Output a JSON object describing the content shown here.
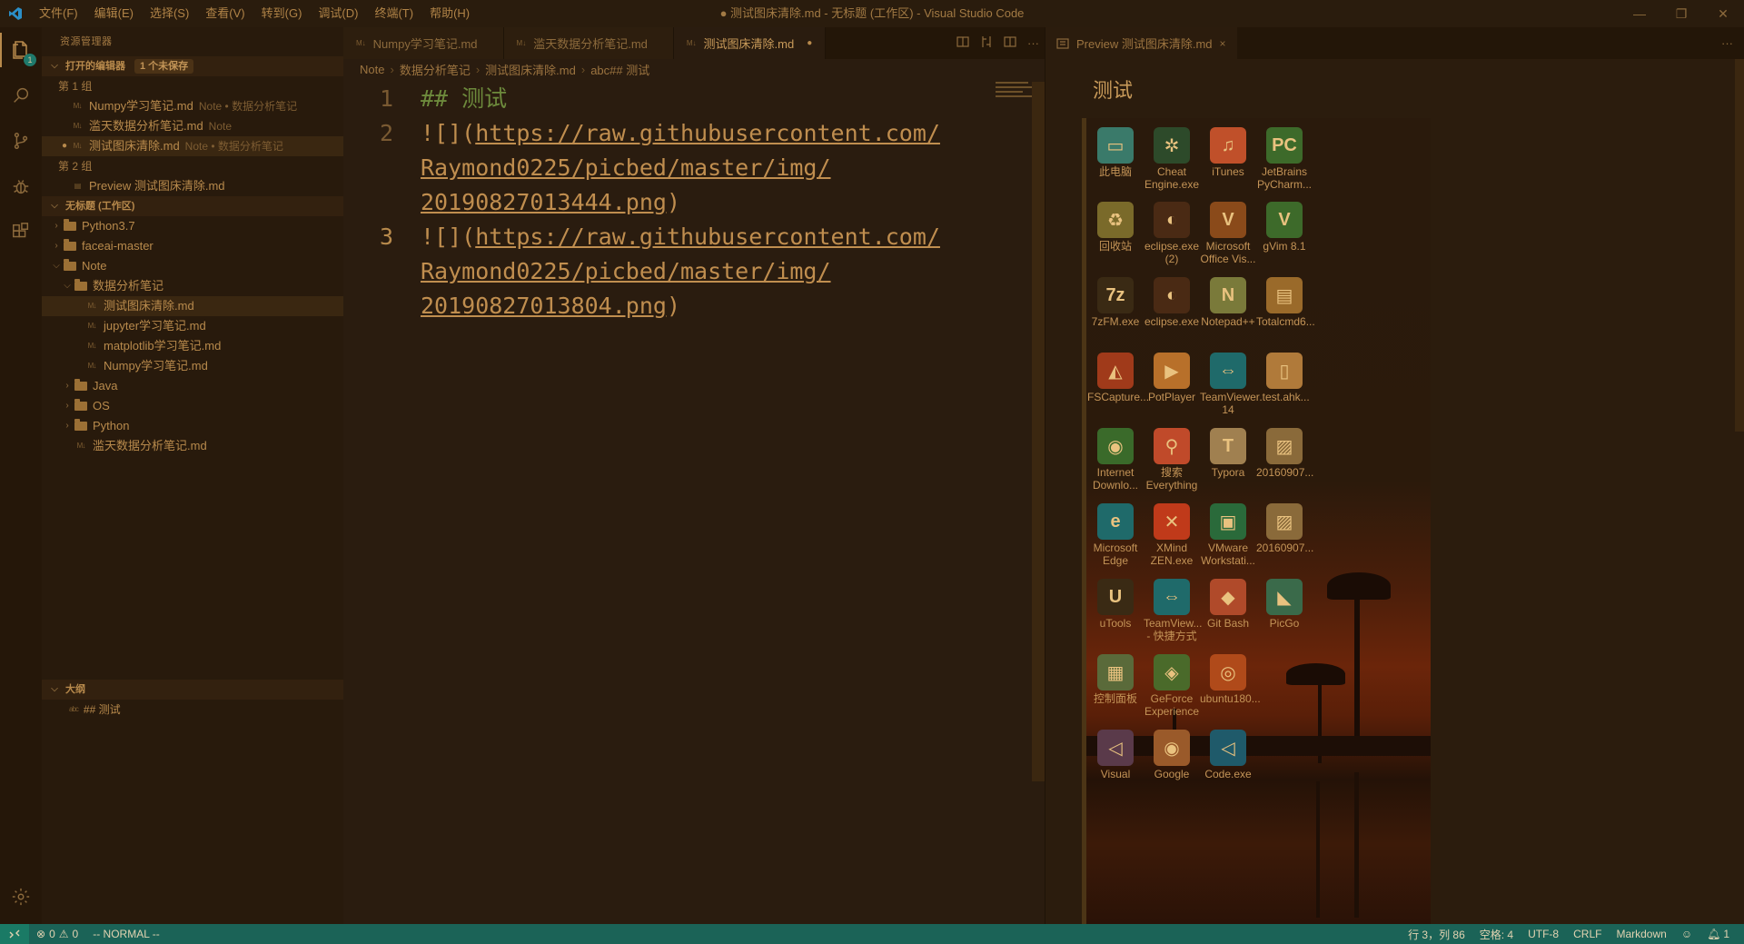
{
  "window": {
    "title": "● 测试图床清除.md - 无标题 (工作区) - Visual Studio Code",
    "menu": [
      "文件(F)",
      "编辑(E)",
      "选择(S)",
      "查看(V)",
      "转到(G)",
      "调试(D)",
      "终端(T)",
      "帮助(H)"
    ],
    "controls": {
      "minimize": "—",
      "restore": "❐",
      "close": "✕"
    }
  },
  "activity": {
    "explorer_badge": "1",
    "icons": [
      "files-icon",
      "search-icon",
      "source-control-icon",
      "debug-icon",
      "extensions-icon"
    ]
  },
  "sidebar": {
    "title": "资源管理器",
    "open_editors": {
      "label": "打开的编辑器",
      "unsaved_badge": "1 个未保存",
      "groups": [
        {
          "label": "第 1 组",
          "items": [
            {
              "name": "Numpy学习笔记.md",
              "desc": "Note • 数据分析笔记",
              "dirty": false
            },
            {
              "name": "滥天数据分析笔记.md",
              "desc": "Note",
              "dirty": false
            },
            {
              "name": "测试图床清除.md",
              "desc": "Note • 数据分析笔记",
              "dirty": true
            }
          ]
        },
        {
          "label": "第 2 组",
          "items": [
            {
              "name": "Preview 测试图床清除.md",
              "desc": "",
              "dirty": false
            }
          ]
        }
      ]
    },
    "workspace": {
      "label": "无标题 (工作区)",
      "tree": [
        {
          "name": "Python3.7",
          "depth": 0,
          "kind": "root",
          "open": false
        },
        {
          "name": "faceai-master",
          "depth": 0,
          "kind": "root",
          "open": false
        },
        {
          "name": "Note",
          "depth": 0,
          "kind": "root",
          "open": true
        },
        {
          "name": "数据分析笔记",
          "depth": 1,
          "kind": "folder",
          "open": true
        },
        {
          "name": "测试图床清除.md",
          "depth": 2,
          "kind": "file",
          "selected": true
        },
        {
          "name": "jupyter学习笔记.md",
          "depth": 2,
          "kind": "file"
        },
        {
          "name": "matplotlib学习笔记.md",
          "depth": 2,
          "kind": "file"
        },
        {
          "name": "Numpy学习笔记.md",
          "depth": 2,
          "kind": "file"
        },
        {
          "name": "Java",
          "depth": 1,
          "kind": "folder",
          "open": false
        },
        {
          "name": "OS",
          "depth": 1,
          "kind": "folder",
          "open": false
        },
        {
          "name": "Python",
          "depth": 1,
          "kind": "folder",
          "open": false
        },
        {
          "name": "滥天数据分析笔记.md",
          "depth": 1,
          "kind": "file"
        }
      ]
    },
    "outline": {
      "label": "大纲",
      "items": [
        {
          "prefix": "abc",
          "text": "## 测试"
        }
      ]
    }
  },
  "editor": {
    "tabs": [
      {
        "label": "Numpy学习笔记.md",
        "active": false,
        "dirty": false
      },
      {
        "label": "滥天数据分析笔记.md",
        "active": false,
        "dirty": false
      },
      {
        "label": "测试图床清除.md",
        "active": true,
        "dirty": true
      }
    ],
    "tab_actions": [
      "open-preview-icon",
      "compare-icon",
      "split-editor-icon",
      "more-actions-icon"
    ],
    "breadcrumb": [
      "Note",
      "数据分析笔记",
      "测试图床清除.md",
      "abc## 测试"
    ],
    "lines": [
      {
        "num": "1",
        "segments": [
          {
            "t": "## 测试",
            "c": "hd"
          }
        ]
      },
      {
        "num": "2",
        "segments": [
          {
            "t": "![](",
            "c": ""
          },
          {
            "t": "https://raw.githubusercontent.com/",
            "c": "lnk"
          },
          {
            "t": "\n",
            "c": ""
          },
          {
            "t": "Raymond0225/picbed/master/img/",
            "c": "lnk"
          },
          {
            "t": "\n",
            "c": ""
          },
          {
            "t": "20190827013444.png",
            "c": "lnk"
          },
          {
            "t": ")",
            "c": ""
          }
        ]
      },
      {
        "num": "3",
        "segments": [
          {
            "t": "![](",
            "c": ""
          },
          {
            "t": "https://raw.githubusercontent.com/",
            "c": "lnk"
          },
          {
            "t": "\n",
            "c": ""
          },
          {
            "t": "Raymond0225/picbed/master/img/",
            "c": "lnk"
          },
          {
            "t": "\n",
            "c": ""
          },
          {
            "t": "20190827013804.png",
            "c": "lnk"
          },
          {
            "t": ")",
            "c": ""
          }
        ]
      }
    ]
  },
  "preview": {
    "tab_label": "Preview 测试图床清除.md",
    "close": "×",
    "more": "···",
    "heading": "测试",
    "desktop_icons": [
      {
        "label": "此电脑",
        "glyph": "▭",
        "color": "#3a7a6a"
      },
      {
        "label": "Cheat Engine.exe",
        "glyph": "✲",
        "color": "#2d4a2a"
      },
      {
        "label": "iTunes",
        "glyph": "♫",
        "color": "#c0502a"
      },
      {
        "label": "JetBrains PyCharm...",
        "glyph": "PC",
        "color": "#3d6a2a"
      },
      {
        "label": "回收站",
        "glyph": "♻",
        "color": "#7a6a2a"
      },
      {
        "label": "eclipse.exe (2)",
        "glyph": "◐",
        "color": "#4a2a14"
      },
      {
        "label": "Microsoft Office Vis...",
        "glyph": "V",
        "color": "#8a4a1a"
      },
      {
        "label": "gVim 8.1",
        "glyph": "V",
        "color": "#3d6a2a"
      },
      {
        "label": "7zFM.exe",
        "glyph": "7z",
        "color": "#3a2a14"
      },
      {
        "label": "eclipse.exe",
        "glyph": "◐",
        "color": "#4a2a14"
      },
      {
        "label": "Notepad++",
        "glyph": "N",
        "color": "#7a7a3a"
      },
      {
        "label": "Totalcmd6...",
        "glyph": "▤",
        "color": "#9a6a2a"
      },
      {
        "label": "FSCapture...",
        "glyph": "◭",
        "color": "#a03a1a"
      },
      {
        "label": "PotPlayer",
        "glyph": "▶",
        "color": "#b8702a"
      },
      {
        "label": "TeamViewer 14",
        "glyph": "⇔",
        "color": "#1f6a6a"
      },
      {
        "label": ".test.ahk...",
        "glyph": "▯",
        "color": "#b07a3a"
      },
      {
        "label": "Internet Downlo...",
        "glyph": "◉",
        "color": "#3a6a2a"
      },
      {
        "label": "搜索 Everything",
        "glyph": "⚲",
        "color": "#c04a2a"
      },
      {
        "label": "Typora",
        "glyph": "T",
        "color": "#a08050"
      },
      {
        "label": "20160907...",
        "glyph": "▨",
        "color": "#8a6a3a"
      },
      {
        "label": "Microsoft Edge",
        "glyph": "e",
        "color": "#1f6a6a"
      },
      {
        "label": "XMind ZEN.exe",
        "glyph": "✕",
        "color": "#c03a1a"
      },
      {
        "label": "VMware Workstati...",
        "glyph": "▣",
        "color": "#2a6a3a"
      },
      {
        "label": "20160907...",
        "glyph": "▨",
        "color": "#8a6a3a"
      },
      {
        "label": "uTools",
        "glyph": "U",
        "color": "#3a2a14"
      },
      {
        "label": "TeamView... - 快捷方式",
        "glyph": "⇔",
        "color": "#1f6a6a"
      },
      {
        "label": "Git Bash",
        "glyph": "◆",
        "color": "#b04a2a"
      },
      {
        "label": "PicGo",
        "glyph": "◣",
        "color": "#3a6a4a"
      },
      {
        "label": "控制面板",
        "glyph": "▦",
        "color": "#5a6a3a"
      },
      {
        "label": "GeForce Experience",
        "glyph": "◈",
        "color": "#4a6a2a"
      },
      {
        "label": "ubuntu180...",
        "glyph": "◎",
        "color": "#b04a1a"
      },
      {
        "label": "",
        "glyph": "",
        "color": ""
      },
      {
        "label": "Visual",
        "glyph": "◁",
        "color": "#5a3a4a"
      },
      {
        "label": "Google",
        "glyph": "◉",
        "color": "#9a5a2a"
      },
      {
        "label": "Code.exe",
        "glyph": "◁",
        "color": "#1f5a6a"
      }
    ]
  },
  "statusbar": {
    "errors": "0",
    "warnings": "0",
    "mode": "-- NORMAL --",
    "position": "行 3，列 86",
    "spaces": "空格: 4",
    "encoding": "UTF-8",
    "eol": "CRLF",
    "language": "Markdown",
    "notifications": "1"
  },
  "colors": {
    "accent": "#1b6357",
    "text": "#b88a4c",
    "background": "#2a1c0f"
  }
}
